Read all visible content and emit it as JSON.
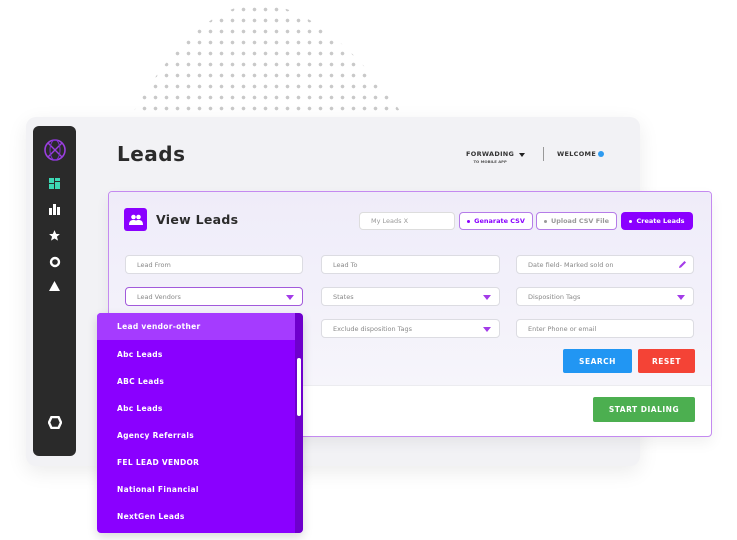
{
  "sidebar": {
    "logo": "globe-logo-icon",
    "items": [
      {
        "icon": "dashboard-icon",
        "active": true
      },
      {
        "icon": "bar-chart-icon",
        "active": false
      },
      {
        "icon": "star-icon",
        "active": false
      },
      {
        "icon": "circle-icon",
        "active": false
      },
      {
        "icon": "triangle-icon",
        "active": false
      }
    ],
    "bottom_icon": "hexagon-icon"
  },
  "header": {
    "title": "Leads",
    "forwarding_label": "FORWADING",
    "forwarding_sub": "TO MOBILE APP",
    "welcome_label": "WELCOME",
    "welcome_dot_color": "#2e9bf0"
  },
  "panel": {
    "title": "View Leads",
    "my_leads_value": "My Leads X",
    "generate_csv_label": "Genarate CSV",
    "upload_csv_label": "Upload CSV File",
    "create_leads_label": "Create Leads",
    "fields": {
      "lead_from": "Lead From",
      "lead_to": "Lead To",
      "date_field": "Date field- Marked sold on",
      "lead_vendors": "Lead Vendors",
      "states": "States",
      "disposition_tags": "Disposition Tags",
      "exclude_disposition_tags": "Exclude disposition Tags",
      "phone_email": "Enter Phone or email"
    },
    "search_label": "SEARCH",
    "reset_label": "RESET",
    "start_dialing_label": "START DIALING"
  },
  "vendor_dropdown": {
    "items": [
      "Lead vendor-other",
      "Abc Leads",
      "ABC Leads",
      "Abc Leads",
      "Agency Referrals",
      "FEL LEAD VENDOR",
      "National Financial",
      "NextGen Leads"
    ],
    "highlighted_index": 0
  },
  "colors": {
    "accent": "#8a00ff",
    "search": "#2196f3",
    "reset": "#f44336",
    "dial": "#4caf50",
    "sidebar": "#2a2a2a",
    "active_nav": "#3dd9b5"
  }
}
